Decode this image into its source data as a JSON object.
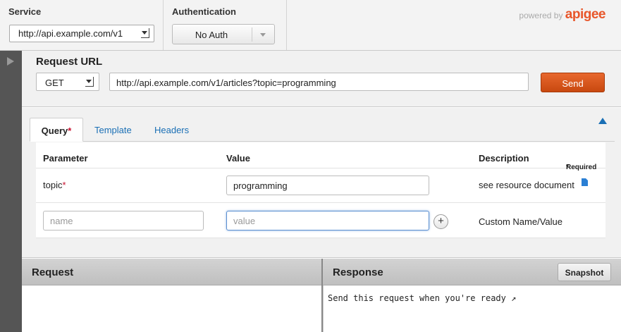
{
  "top": {
    "service_label": "Service",
    "service_value": "http://api.example.com/v1",
    "auth_label": "Authentication",
    "auth_value": "No Auth",
    "powered_by": "powered by",
    "brand": "apigee"
  },
  "request_url": {
    "title": "Request URL",
    "method": "GET",
    "url": "http://api.example.com/v1/articles?topic=programming",
    "send_label": "Send"
  },
  "tabs": [
    {
      "label": "Query",
      "required_mark": "*",
      "active": true
    },
    {
      "label": "Template"
    },
    {
      "label": "Headers"
    }
  ],
  "params": {
    "headers": {
      "parameter": "Parameter",
      "value": "Value",
      "description": "Description",
      "required_note_mark": "*",
      "required_note": "Required"
    },
    "rows": [
      {
        "name": "topic",
        "required_mark": "*",
        "value": "programming",
        "description": "see resource document"
      }
    ],
    "custom_row": {
      "name_placeholder": "name",
      "value_placeholder": "value",
      "add_label": "+",
      "description": "Custom Name/Value"
    }
  },
  "panes": {
    "request_title": "Request",
    "response_title": "Response",
    "snapshot_label": "Snapshot",
    "response_text": "Send this request when you're ready ↗"
  },
  "colors": {
    "accent_orange": "#d9531e",
    "link_blue": "#1a6fb5",
    "required_red": "#c8102e"
  }
}
